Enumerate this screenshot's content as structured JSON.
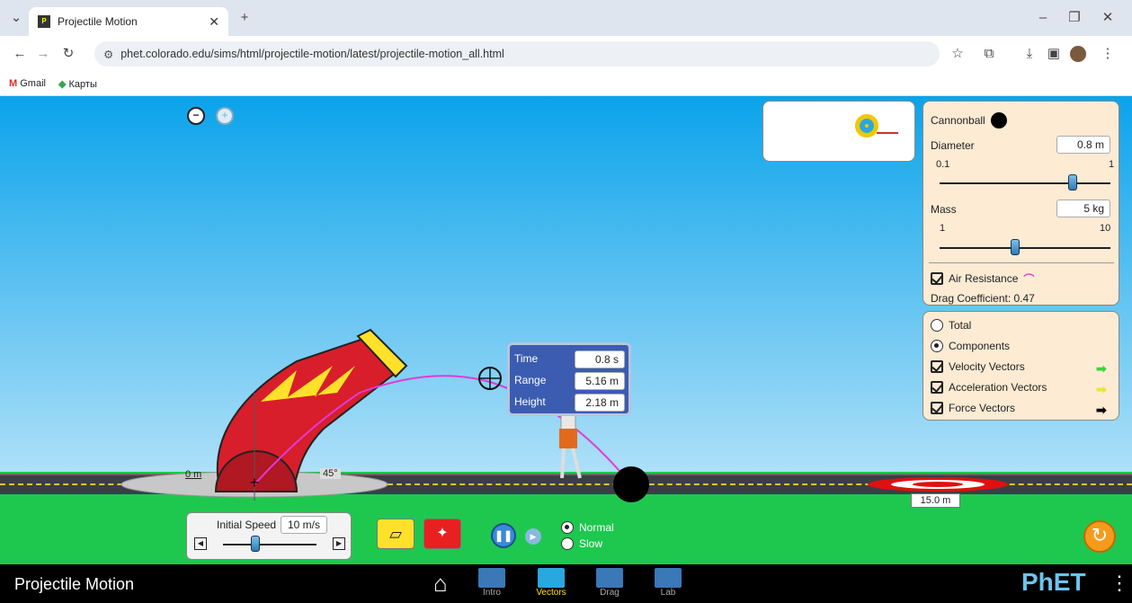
{
  "browser": {
    "tab_title": "Projectile Motion",
    "url": "phet.colorado.edu/sims/html/projectile-motion/latest/projectile-motion_all.html",
    "bookmarks": [
      "Gmail",
      "Карты"
    ]
  },
  "measure": {
    "time_label": "Time",
    "time_value": "0.8 s",
    "range_label": "Range",
    "range_value": "5.16 m",
    "height_label": "Height",
    "height_value": "2.18 m"
  },
  "scene": {
    "origin_label": "0 m",
    "angle_label": "45°",
    "target_distance": "15.0 m"
  },
  "projectile_panel": {
    "name": "Cannonball",
    "diameter_label": "Diameter",
    "diameter_value": "0.8 m",
    "diameter_min": "0.1",
    "diameter_max": "1",
    "diameter_level": 0.78,
    "mass_label": "Mass",
    "mass_value": "5 kg",
    "mass_min": "1",
    "mass_max": "10",
    "mass_level": 0.44,
    "air_resistance_label": "Air Resistance",
    "drag_label": "Drag Coefficient: 0.47"
  },
  "vectors_panel": {
    "total_label": "Total",
    "components_label": "Components",
    "velocity_label": "Velocity Vectors",
    "acceleration_label": "Acceleration Vectors",
    "force_label": "Force Vectors",
    "velocity_color": "#3cd43c",
    "acceleration_color": "#ffff55",
    "force_color": "#000000"
  },
  "speed_control": {
    "label": "Initial Speed",
    "value": "10 m/s",
    "level": 0.35
  },
  "playback": {
    "normal_label": "Normal",
    "slow_label": "Slow"
  },
  "navbar": {
    "title": "Projectile Motion",
    "screens": [
      "Intro",
      "Vectors",
      "Drag",
      "Lab"
    ],
    "selected": "Vectors",
    "logo": "PhET"
  }
}
